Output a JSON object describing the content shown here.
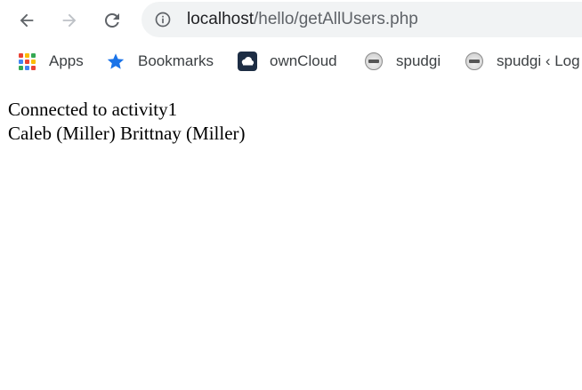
{
  "toolbar": {
    "back_icon": "arrow-left-icon",
    "forward_icon": "arrow-right-icon",
    "reload_icon": "reload-icon",
    "address": {
      "info_icon": "info-circle-icon",
      "host": "localhost",
      "path": "/hello/getAllUsers.php"
    }
  },
  "bookmarks": {
    "items": [
      {
        "label": "Apps",
        "icon": "apps-grid-icon"
      },
      {
        "label": "Bookmarks",
        "icon": "star-icon"
      },
      {
        "label": "ownCloud",
        "icon": "owncloud-icon"
      },
      {
        "label": "spudgi",
        "icon": "spudgi-favicon"
      },
      {
        "label": "spudgi ‹ Log",
        "icon": "spudgi-favicon"
      }
    ]
  },
  "page": {
    "line1": "Connected to activity1",
    "line2": "Caleb (Miller) Brittnay (Miller)"
  },
  "colors": {
    "omnibox_bg": "#f1f3f4",
    "icon_gray": "#5f6368",
    "icon_disabled": "#bdc1c6",
    "star_blue": "#1a73e8",
    "owncloud_bg": "#1d2d44"
  }
}
